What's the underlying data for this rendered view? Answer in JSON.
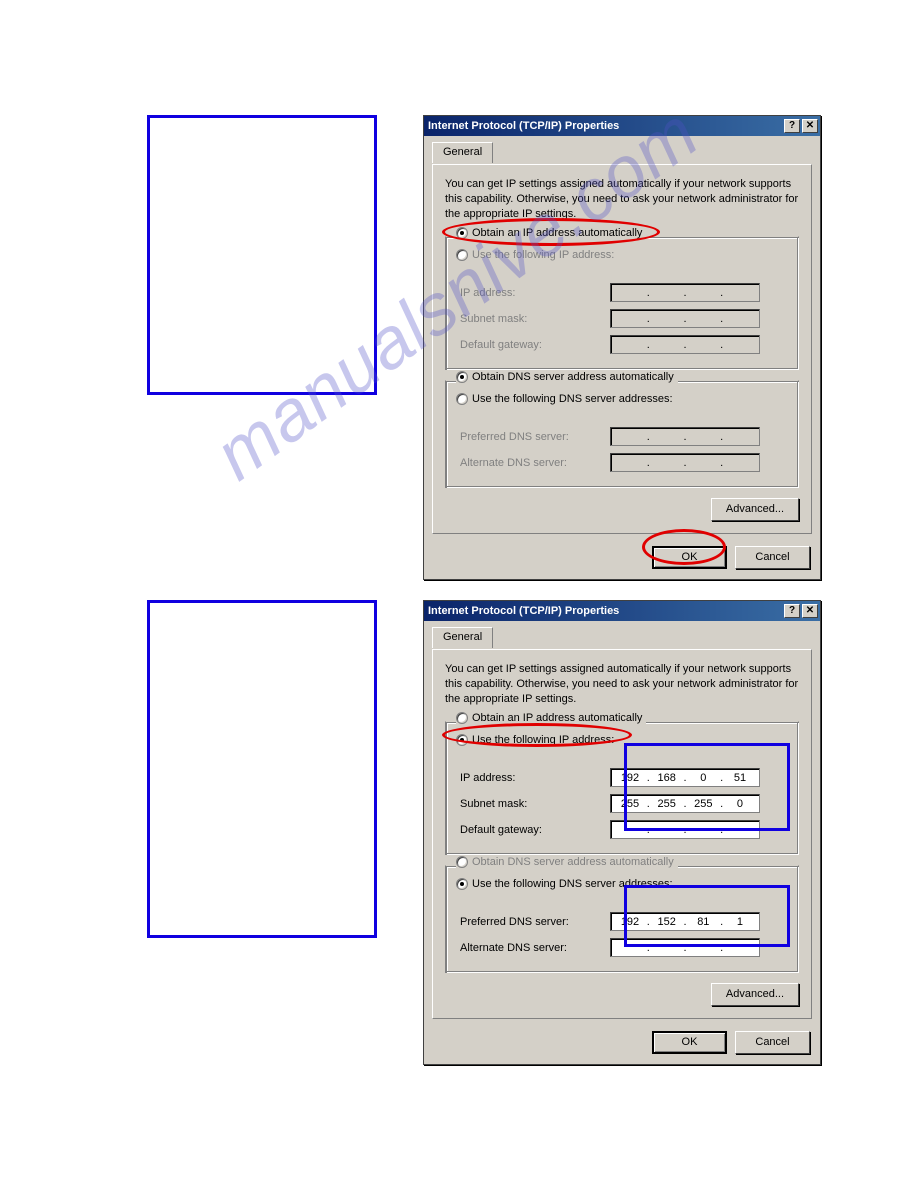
{
  "watermark": "manualsnive.com",
  "dialog1": {
    "title": "Internet Protocol (TCP/IP) Properties",
    "tab": "General",
    "desc": "You can get IP settings assigned automatically if your network supports this capability. Otherwise, you need to ask your network administrator for the appropriate IP settings.",
    "opt_auto_ip": "Obtain an IP address automatically",
    "opt_manual_ip": "Use the following IP address:",
    "lbl_ip": "IP address:",
    "lbl_subnet": "Subnet mask:",
    "lbl_gateway": "Default gateway:",
    "opt_auto_dns": "Obtain DNS server address automatically",
    "opt_manual_dns": "Use the following DNS server addresses:",
    "lbl_pref_dns": "Preferred DNS server:",
    "lbl_alt_dns": "Alternate DNS server:",
    "btn_advanced": "Advanced...",
    "btn_ok": "OK",
    "btn_cancel": "Cancel",
    "ip_selected": "auto",
    "dns_selected": "auto",
    "ip": [
      "",
      "",
      "",
      ""
    ],
    "subnet": [
      "",
      "",
      "",
      ""
    ],
    "gateway": [
      "",
      "",
      "",
      ""
    ],
    "pref_dns": [
      "",
      "",
      "",
      ""
    ],
    "alt_dns": [
      "",
      "",
      "",
      ""
    ]
  },
  "dialog2": {
    "title": "Internet Protocol (TCP/IP) Properties",
    "tab": "General",
    "desc": "You can get IP settings assigned automatically if your network supports this capability. Otherwise, you need to ask your network administrator for the appropriate IP settings.",
    "opt_auto_ip": "Obtain an IP address automatically",
    "opt_manual_ip": "Use the following IP address:",
    "lbl_ip": "IP address:",
    "lbl_subnet": "Subnet mask:",
    "lbl_gateway": "Default gateway:",
    "opt_auto_dns": "Obtain DNS server address automatically",
    "opt_manual_dns": "Use the following DNS server addresses:",
    "lbl_pref_dns": "Preferred DNS server:",
    "lbl_alt_dns": "Alternate DNS server:",
    "btn_advanced": "Advanced...",
    "btn_ok": "OK",
    "btn_cancel": "Cancel",
    "ip_selected": "manual",
    "dns_selected": "manual",
    "ip": [
      "192",
      "168",
      "0",
      "51"
    ],
    "subnet": [
      "255",
      "255",
      "255",
      "0"
    ],
    "gateway": [
      "",
      "",
      "",
      ""
    ],
    "pref_dns": [
      "192",
      "152",
      "81",
      "1"
    ],
    "alt_dns": [
      "",
      "",
      "",
      ""
    ]
  }
}
